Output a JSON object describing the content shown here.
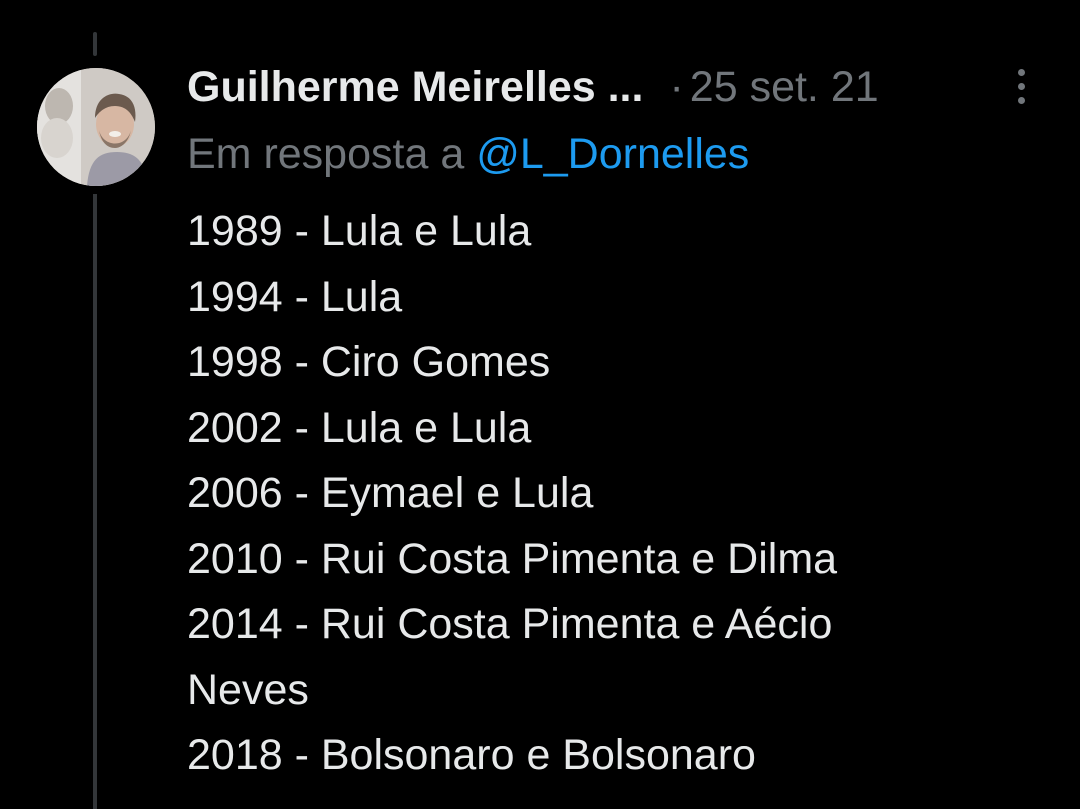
{
  "tweet": {
    "author": {
      "display_name": "Guilherme Meirelles ...",
      "avatar_icon": "profile-photo"
    },
    "separator": "·",
    "timestamp": "25 set. 21",
    "more_icon": "more-dots-vertical-icon",
    "reply": {
      "prefix": "Em resposta a",
      "mention": "@L_Dornelles"
    },
    "lines": [
      "1989 - Lula e Lula",
      "1994 - Lula",
      "1998 - Ciro Gomes",
      "2002 - Lula e Lula",
      "2006 - Eymael e Lula",
      "2010 - Rui Costa Pimenta e Dilma",
      "2014 - Rui Costa Pimenta e Aécio",
      "Neves",
      "2018 - Bolsonaro e Bolsonaro"
    ]
  },
  "colors": {
    "background": "#000000",
    "text": "#e7e9ea",
    "secondary": "#71767b",
    "link": "#1d9bf0",
    "thread_line": "#333639"
  }
}
